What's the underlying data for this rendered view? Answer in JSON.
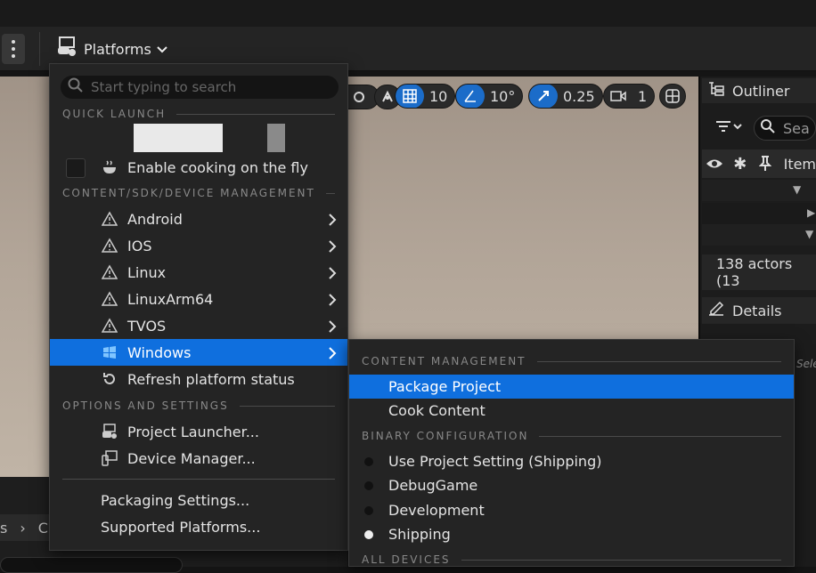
{
  "toolbar": {
    "platforms_label": "Platforms"
  },
  "viewport_tools": {
    "grid_value": "10",
    "angle_value": "10°",
    "scale_value": "0.25",
    "camera_value": "1"
  },
  "outliner": {
    "title": "Outliner",
    "search_placeholder": "Sea",
    "column_item": "Item",
    "actor_count": "138 actors (13"
  },
  "details": {
    "title": "Details",
    "partial_text": "Sele"
  },
  "breadcrumbs": [
    "s",
    "C"
  ],
  "menu": {
    "search_placeholder": "Start typing to search",
    "quick_launch_header": "QUICK LAUNCH",
    "enable_cooking_label": "Enable cooking on the fly",
    "content_mgmt_header": "CONTENT/SDK/DEVICE MANAGEMENT",
    "platforms": [
      "Android",
      "IOS",
      "Linux",
      "LinuxArm64",
      "TVOS",
      "Windows"
    ],
    "refresh_label": "Refresh platform status",
    "options_header": "OPTIONS AND SETTINGS",
    "project_launcher_label": "Project Launcher...",
    "device_manager_label": "Device Manager...",
    "packaging_settings_label": "Packaging Settings...",
    "supported_platforms_label": "Supported Platforms..."
  },
  "submenu": {
    "content_header": "CONTENT MANAGEMENT",
    "package_project_label": "Package Project",
    "cook_content_label": "Cook Content",
    "binary_header": "BINARY CONFIGURATION",
    "configs": [
      "Use Project Setting (Shipping)",
      "DebugGame",
      "Development",
      "Shipping"
    ],
    "selected_config": "Shipping",
    "all_devices_header": "ALL DEVICES"
  },
  "colors": {
    "accent": "#0f6fde",
    "menu_bg": "#242424",
    "panel_bg": "#1c1c1c"
  }
}
